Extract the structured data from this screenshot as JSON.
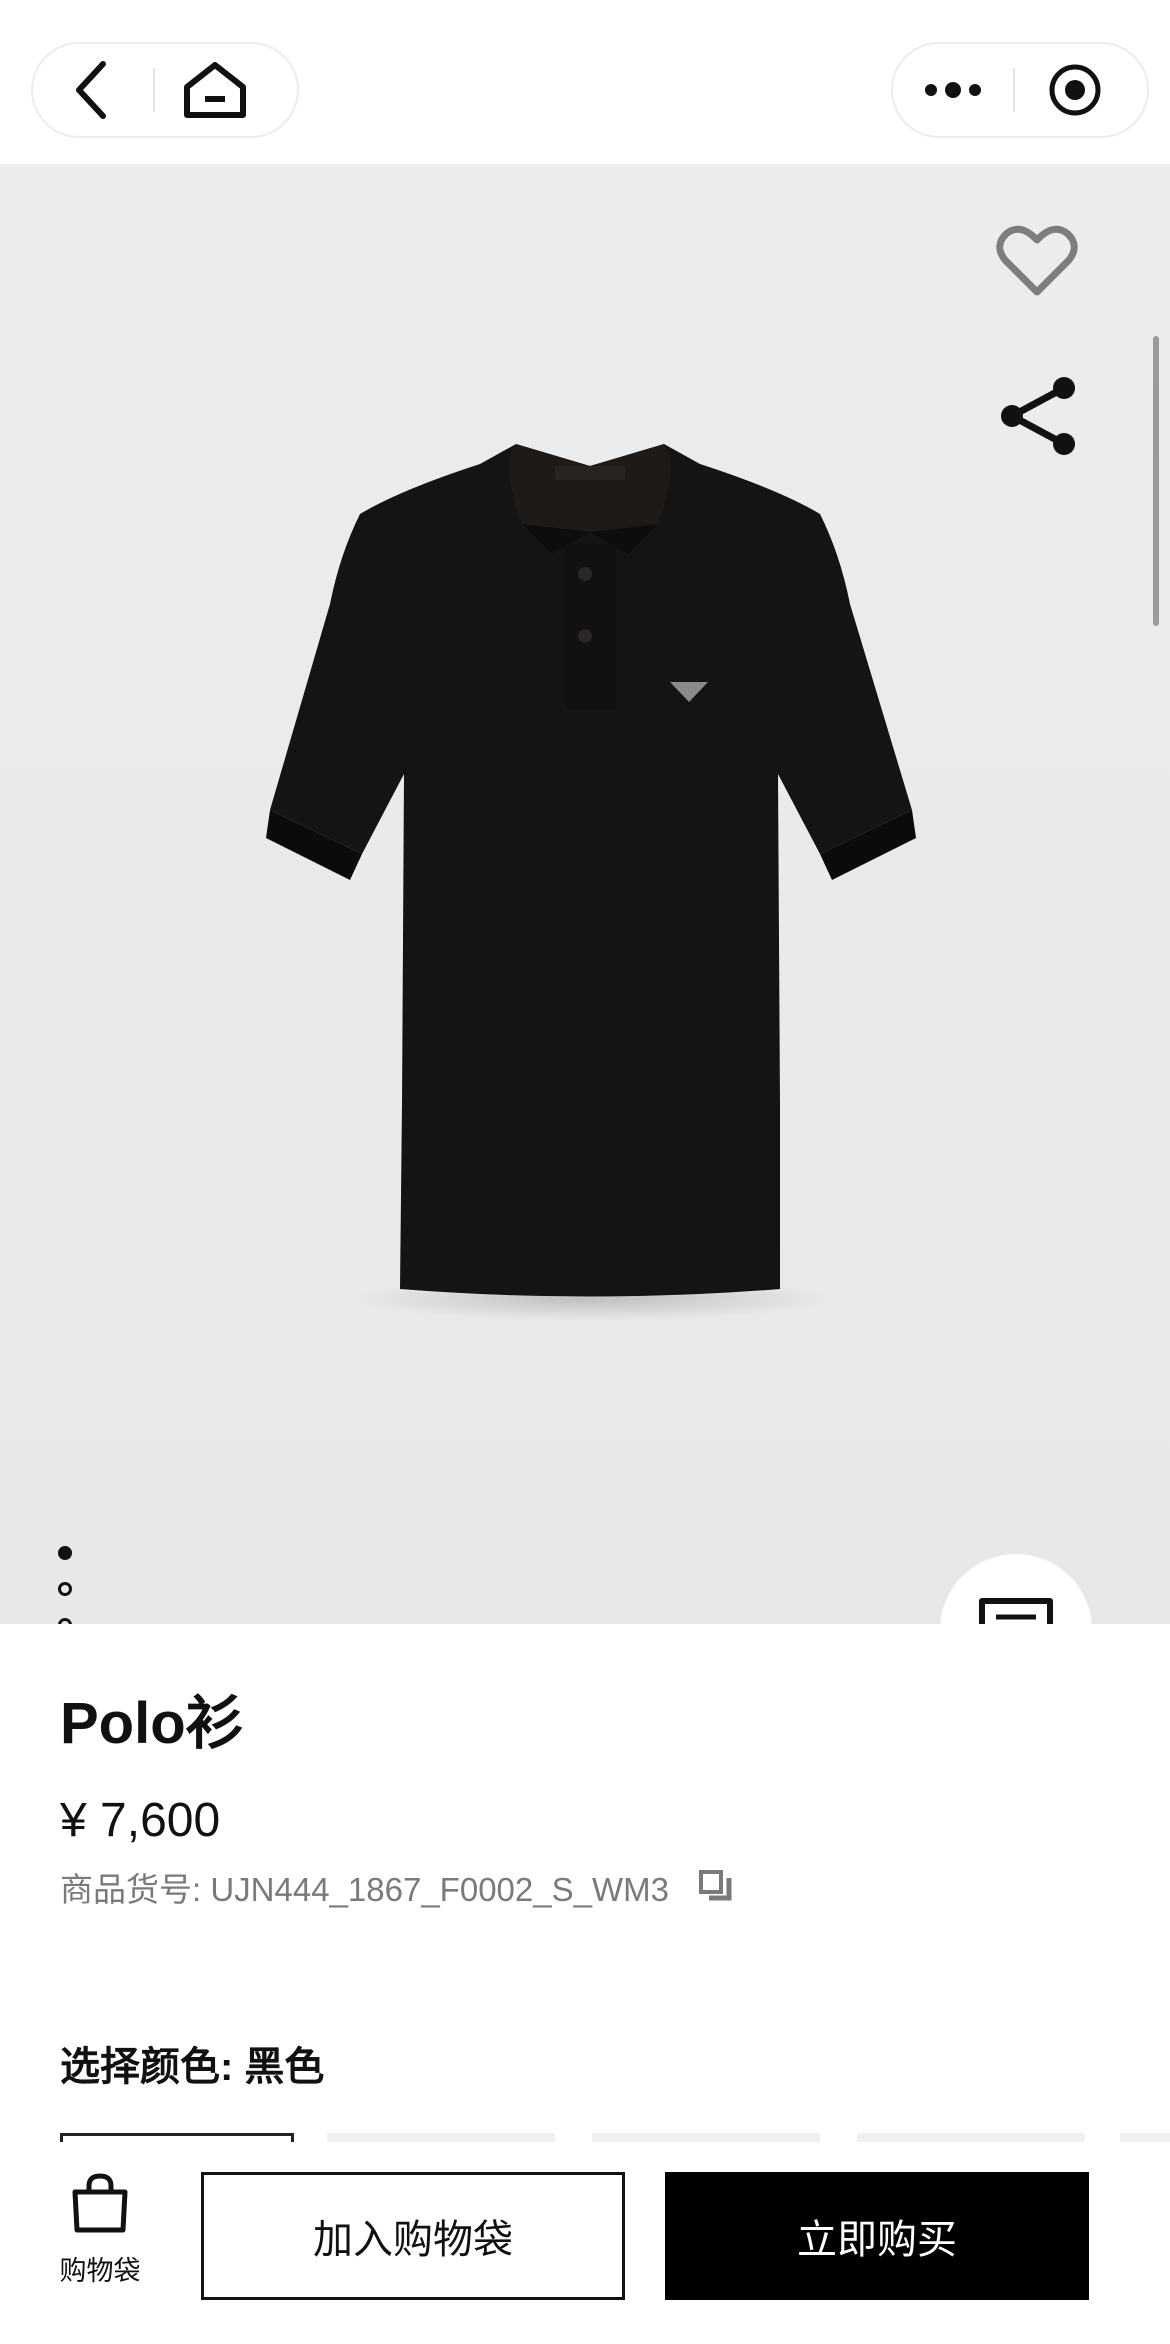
{
  "nav": {
    "back_icon": "back-icon",
    "home_icon": "home-icon",
    "more_icon": "more-icon",
    "close_icon": "target-icon"
  },
  "gallery": {
    "image": "black-polo-shirt",
    "current_index": 1,
    "total": 5,
    "favorite_icon": "heart-icon",
    "share_icon": "share-icon",
    "chat_icon": "chat-icon"
  },
  "product": {
    "title": "Polo衫",
    "price": "¥ 7,600",
    "sku_label": "商品货号: UJN444_1867_F0002_S_WM3",
    "copy_icon": "copy-icon",
    "color_label": "选择颜色: 黑色"
  },
  "bottom": {
    "bag_label": "购物袋",
    "add_to_bag": "加入购物袋",
    "buy_now": "立即购买"
  },
  "colors": {
    "accent": "#000000",
    "background": "#ffffff",
    "hero_bg": "#ebebeb",
    "muted_text": "#7a7a7a"
  }
}
